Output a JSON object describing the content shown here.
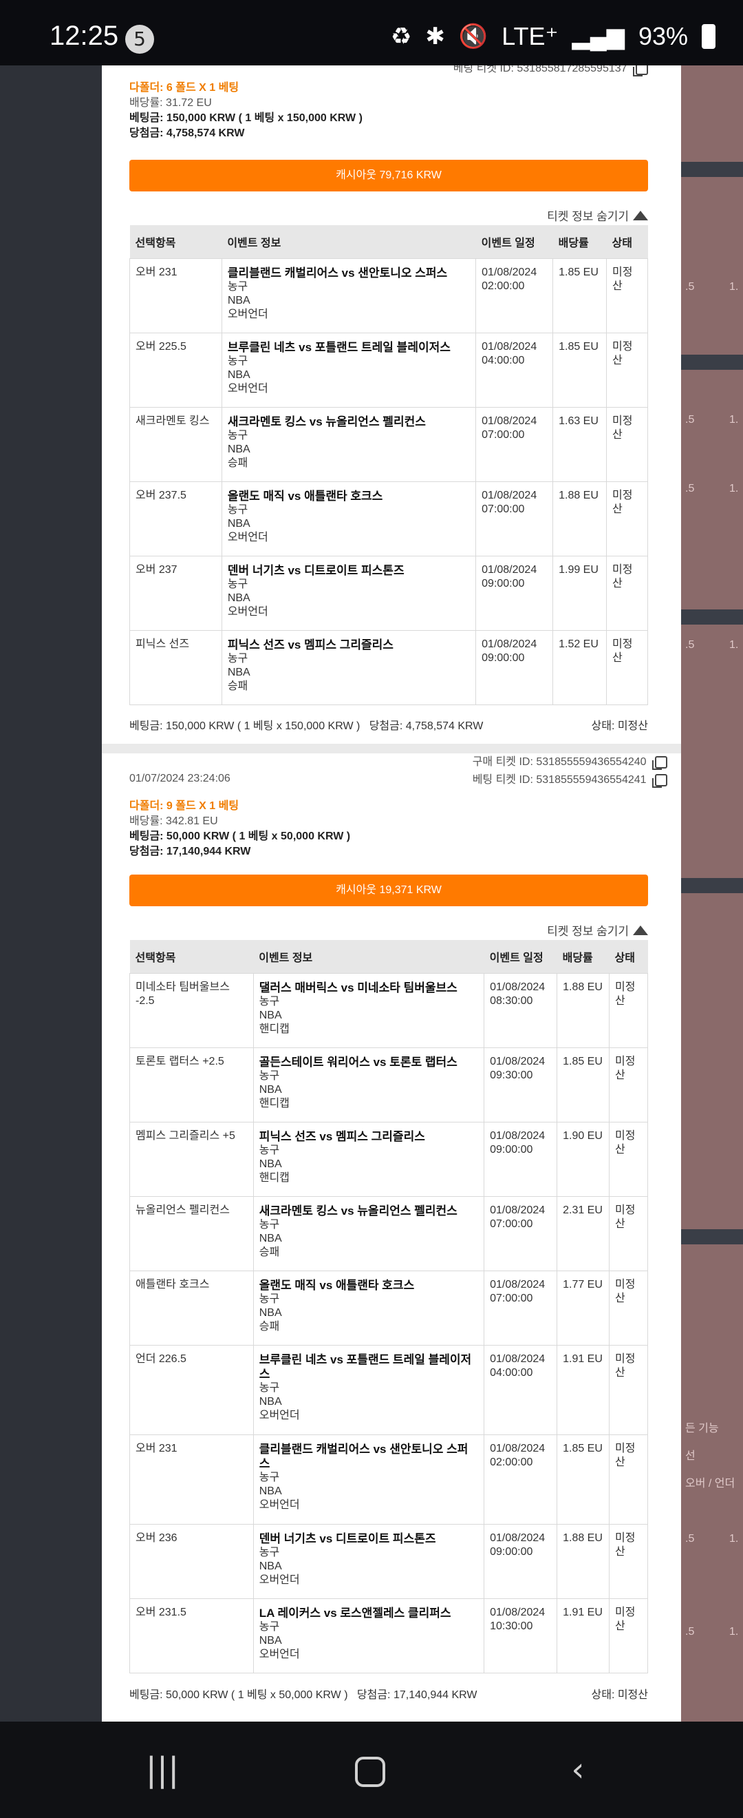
{
  "status_bar": {
    "time": "12:25",
    "notif_count": "5",
    "network": "LTE⁺",
    "battery": "93%"
  },
  "ticket1": {
    "top_partial_id_label": "베팅 티켓 ID:",
    "top_partial_id": "531855817285595137",
    "title": "다폴더: 6 폴드 X 1 베팅",
    "odds": "배당률: 31.72 EU",
    "stake": "베팅금: 150,000 KRW ( 1 베팅 x 150,000 KRW )",
    "payout": "당첨금: 4,758,574 KRW",
    "cashout": "캐시아웃 79,716 KRW",
    "hide": "티켓 정보 숨기기",
    "headers": [
      "선택항목",
      "이벤트 정보",
      "이벤트 일정",
      "배당률",
      "상태"
    ],
    "rows": [
      {
        "sel": "오버 231",
        "title": "클리블랜드 캐벌리어스 vs 샌안토니오 스퍼스",
        "l1": "농구",
        "l2": "NBA",
        "l3": "오버언더",
        "date": "01/08/2024",
        "time": "02:00:00",
        "odds": "1.85 EU",
        "status": "미정산"
      },
      {
        "sel": "오버 225.5",
        "title": "브루클린 네츠 vs 포틀랜드 트레일 블레이저스",
        "l1": "농구",
        "l2": "NBA",
        "l3": "오버언더",
        "date": "01/08/2024",
        "time": "04:00:00",
        "odds": "1.85 EU",
        "status": "미정산"
      },
      {
        "sel": "새크라멘토 킹스",
        "title": "새크라멘토 킹스 vs 뉴올리언스 펠리컨스",
        "l1": "농구",
        "l2": "NBA",
        "l3": "승패",
        "date": "01/08/2024",
        "time": "07:00:00",
        "odds": "1.63 EU",
        "status": "미정산"
      },
      {
        "sel": "오버 237.5",
        "title": "올랜도 매직 vs 애틀랜타 호크스",
        "l1": "농구",
        "l2": "NBA",
        "l3": "오버언더",
        "date": "01/08/2024",
        "time": "07:00:00",
        "odds": "1.88 EU",
        "status": "미정산"
      },
      {
        "sel": "오버 237",
        "title": "덴버 너기츠 vs 디트로이트 피스톤즈",
        "l1": "농구",
        "l2": "NBA",
        "l3": "오버언더",
        "date": "01/08/2024",
        "time": "09:00:00",
        "odds": "1.99 EU",
        "status": "미정산"
      },
      {
        "sel": "피닉스 선즈",
        "title": "피닉스 선즈 vs 멤피스 그리즐리스",
        "l1": "농구",
        "l2": "NBA",
        "l3": "승패",
        "date": "01/08/2024",
        "time": "09:00:00",
        "odds": "1.52 EU",
        "status": "미정산"
      }
    ],
    "footer_left": "베팅금: 150,000 KRW ( 1 베팅 x 150,000 KRW )   당첨금: 4,758,574 KRW",
    "footer_right": "상태: 미정산"
  },
  "ticket2": {
    "datetime": "01/07/2024 23:24:06",
    "purchase_id_label": "구매 티켓 ID:",
    "purchase_id": "531855559436554240",
    "bet_id_label": "베팅 티켓 ID:",
    "bet_id": "531855559436554241",
    "title": "다폴더: 9 폴드 X 1 베팅",
    "odds": "배당률: 342.81 EU",
    "stake": "베팅금: 50,000 KRW ( 1 베팅 x 50,000 KRW )",
    "payout": "당첨금: 17,140,944 KRW",
    "cashout": "캐시아웃 19,371 KRW",
    "hide": "티켓 정보 숨기기",
    "headers": [
      "선택항목",
      "이벤트 정보",
      "이벤트 일정",
      "배당률",
      "상태"
    ],
    "rows": [
      {
        "sel": "미네소타 팀버울브스 -2.5",
        "title": "댈러스 매버릭스 vs 미네소타 팀버울브스",
        "l1": "농구",
        "l2": "NBA",
        "l3": "핸디캡",
        "date": "01/08/2024",
        "time": "08:30:00",
        "odds": "1.88 EU",
        "status": "미정산"
      },
      {
        "sel": "토론토 랩터스 +2.5",
        "title": "골든스테이트 워리어스 vs 토론토 랩터스",
        "l1": "농구",
        "l2": "NBA",
        "l3": "핸디캡",
        "date": "01/08/2024",
        "time": "09:30:00",
        "odds": "1.85 EU",
        "status": "미정산"
      },
      {
        "sel": "멤피스 그리즐리스 +5",
        "title": "피닉스 선즈 vs 멤피스 그리즐리스",
        "l1": "농구",
        "l2": "NBA",
        "l3": "핸디캡",
        "date": "01/08/2024",
        "time": "09:00:00",
        "odds": "1.90 EU",
        "status": "미정산"
      },
      {
        "sel": "뉴올리언스 펠리컨스",
        "title": "새크라멘토 킹스 vs 뉴올리언스 펠리컨스",
        "l1": "농구",
        "l2": "NBA",
        "l3": "승패",
        "date": "01/08/2024",
        "time": "07:00:00",
        "odds": "2.31 EU",
        "status": "미정산"
      },
      {
        "sel": "애틀랜타 호크스",
        "title": "올랜도 매직 vs 애틀랜타 호크스",
        "l1": "농구",
        "l2": "NBA",
        "l3": "승패",
        "date": "01/08/2024",
        "time": "07:00:00",
        "odds": "1.77 EU",
        "status": "미정산"
      },
      {
        "sel": "언더 226.5",
        "title": "브루클린 네츠 vs 포틀랜드 트레일 블레이저스",
        "l1": "농구",
        "l2": "NBA",
        "l3": "오버언더",
        "date": "01/08/2024",
        "time": "04:00:00",
        "odds": "1.91 EU",
        "status": "미정산"
      },
      {
        "sel": "오버 231",
        "title": "클리블랜드 캐벌리어스 vs 샌안토니오 스퍼스",
        "l1": "농구",
        "l2": "NBA",
        "l3": "오버언더",
        "date": "01/08/2024",
        "time": "02:00:00",
        "odds": "1.85 EU",
        "status": "미정산"
      },
      {
        "sel": "오버 236",
        "title": "덴버 너기츠 vs 디트로이트 피스톤즈",
        "l1": "농구",
        "l2": "NBA",
        "l3": "오버언더",
        "date": "01/08/2024",
        "time": "09:00:00",
        "odds": "1.88 EU",
        "status": "미정산"
      },
      {
        "sel": "오버 231.5",
        "title": "LA 레이커스 vs 로스앤젤레스 클리퍼스",
        "l1": "농구",
        "l2": "NBA",
        "l3": "오버언더",
        "date": "01/08/2024",
        "time": "10:30:00",
        "odds": "1.91 EU",
        "status": "미정산"
      }
    ],
    "footer_left": "베팅금: 50,000 KRW ( 1 베팅 x 50,000 KRW )   당첨금: 17,140,944 KRW",
    "footer_right": "상태: 미정산"
  },
  "side_panel": {
    "values_a": ".5",
    "values_b": "1.",
    "label_feature": "든 기능",
    "label_line": "선",
    "label_ou": "오버 / 언더"
  },
  "colors": {
    "accent": "#ff7a00",
    "header_bg": "#e7e7e7"
  }
}
